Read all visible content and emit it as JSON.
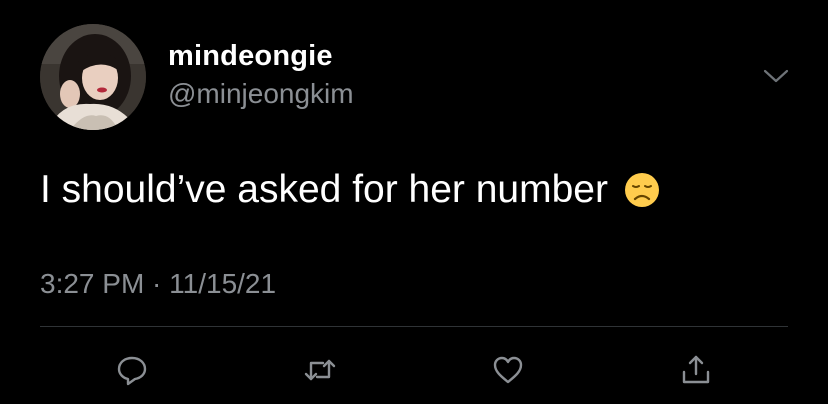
{
  "tweet": {
    "display_name": "mindeongie",
    "handle": "@minjeongkim",
    "text": "I should’ve asked for her number",
    "emoji": "disappointed-face",
    "timestamp": "3:27 PM · 11/15/21"
  },
  "actions": {
    "reply_icon": "reply-icon",
    "retweet_icon": "retweet-icon",
    "like_icon": "heart-icon",
    "share_icon": "share-icon"
  },
  "colors": {
    "background": "#000000",
    "primary_text": "#ffffff",
    "secondary_text": "#8b8f94",
    "divider": "#2f3336",
    "icon": "#8b8f94"
  }
}
